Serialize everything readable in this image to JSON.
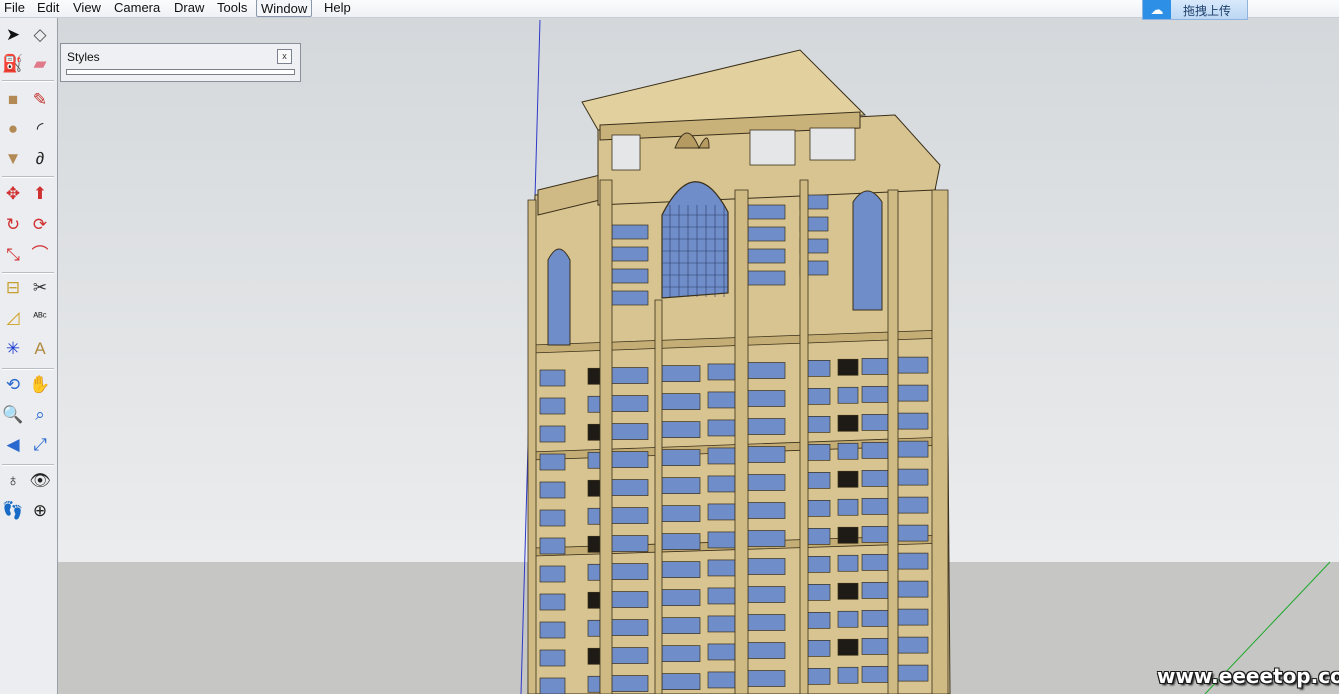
{
  "menu": {
    "items": [
      "File",
      "Edit",
      "View",
      "Camera",
      "Draw",
      "Tools",
      "Window",
      "Help"
    ],
    "active": "Window"
  },
  "upload_badge": {
    "label": "拖拽上传"
  },
  "styles_panel": {
    "title": "Styles",
    "close_glyph": "x"
  },
  "watermark": {
    "text": "www.eeeetop.com"
  },
  "toolbar": {
    "tools": [
      {
        "name": "select-tool-icon",
        "glyph": "➤",
        "color": "#111"
      },
      {
        "name": "make-component-icon",
        "glyph": "◇",
        "color": "#555"
      },
      {
        "name": "paint-bucket-icon",
        "glyph": "⛽",
        "color": "#c08a2a"
      },
      {
        "name": "eraser-icon",
        "glyph": "▰",
        "color": "#e07a8a"
      },
      {
        "name": "rectangle-tool-icon",
        "glyph": "■",
        "color": "#b38a55"
      },
      {
        "name": "line-tool-icon",
        "glyph": "✎",
        "color": "#c0302a"
      },
      {
        "name": "circle-tool-icon",
        "glyph": "●",
        "color": "#b38a55"
      },
      {
        "name": "arc-tool-icon",
        "glyph": "◜",
        "color": "#222"
      },
      {
        "name": "polygon-tool-icon",
        "glyph": "▼",
        "color": "#b38a55"
      },
      {
        "name": "freehand-tool-icon",
        "glyph": "∂",
        "color": "#222"
      },
      {
        "name": "move-tool-icon",
        "glyph": "✥",
        "color": "#d03030"
      },
      {
        "name": "push-pull-icon",
        "glyph": "⬆",
        "color": "#d03030"
      },
      {
        "name": "rotate-tool-icon",
        "glyph": "↻",
        "color": "#d03030"
      },
      {
        "name": "follow-me-icon",
        "glyph": "⟳",
        "color": "#d03030"
      },
      {
        "name": "scale-tool-icon",
        "glyph": "⤡",
        "color": "#d03030"
      },
      {
        "name": "offset-tool-icon",
        "glyph": "⌒",
        "color": "#d03030"
      },
      {
        "name": "tape-measure-icon",
        "glyph": "⊟",
        "color": "#c8a030"
      },
      {
        "name": "dimension-tool-icon",
        "glyph": "✂",
        "color": "#333"
      },
      {
        "name": "protractor-icon",
        "glyph": "◿",
        "color": "#d0a020"
      },
      {
        "name": "text-tool-icon",
        "glyph": "ᴬᴮᶜ",
        "color": "#222"
      },
      {
        "name": "axes-tool-icon",
        "glyph": "✳",
        "color": "#1a3bd0"
      },
      {
        "name": "3d-text-icon",
        "glyph": "A",
        "color": "#b08a40"
      },
      {
        "name": "orbit-tool-icon",
        "glyph": "⟲",
        "color": "#2a6ad0"
      },
      {
        "name": "pan-tool-icon",
        "glyph": "✋",
        "color": "#333"
      },
      {
        "name": "zoom-tool-icon",
        "glyph": "🔍",
        "color": "#333"
      },
      {
        "name": "zoom-window-icon",
        "glyph": "⌕",
        "color": "#2a6ad0"
      },
      {
        "name": "previous-view-icon",
        "glyph": "◀",
        "color": "#2a6ad0"
      },
      {
        "name": "zoom-extents-icon",
        "glyph": "⤢",
        "color": "#2a6ad0"
      },
      {
        "name": "position-camera-icon",
        "glyph": "♁",
        "color": "#222"
      },
      {
        "name": "look-around-icon",
        "glyph": "👁",
        "color": "#222"
      },
      {
        "name": "walk-tool-icon",
        "glyph": "👣",
        "color": "#222"
      },
      {
        "name": "section-plane-icon",
        "glyph": "⊕",
        "color": "#222"
      }
    ]
  },
  "scene": {
    "building_color": "#d8c490",
    "glass_color": "#6f8ec9",
    "outline_color": "#3a2f1a",
    "ground_color": "#c6c7c4",
    "blue_axis_color": "#2e39c8",
    "green_axis_color": "#1ea82a"
  }
}
